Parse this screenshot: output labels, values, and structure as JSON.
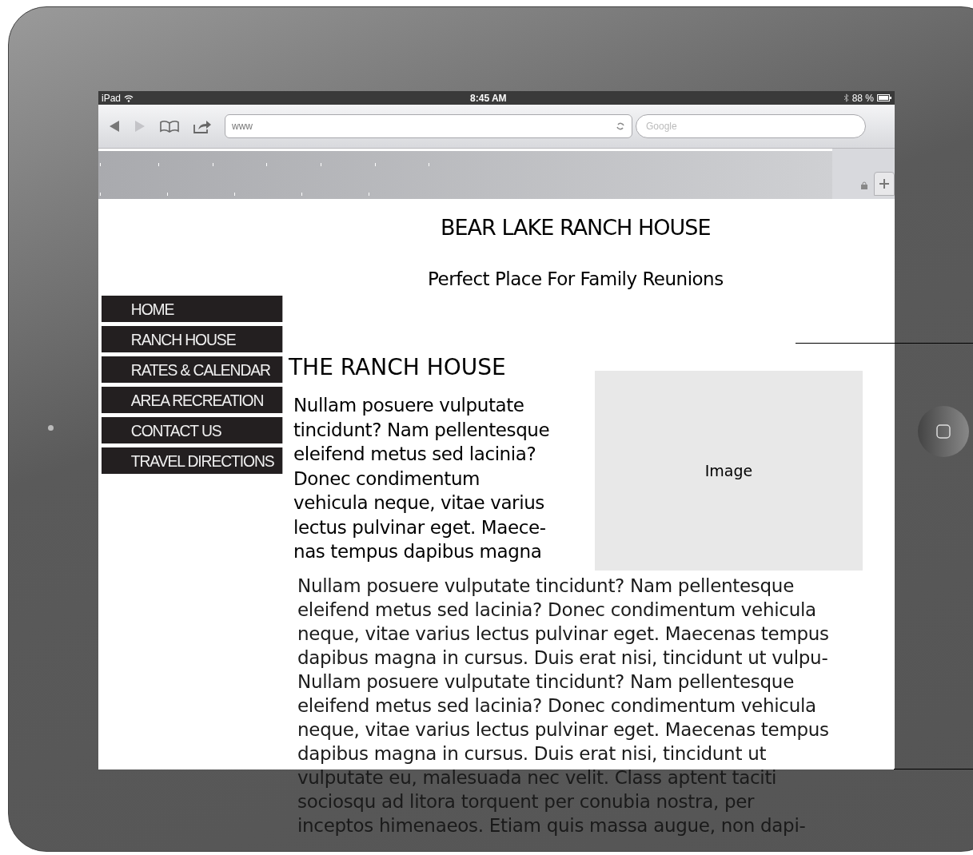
{
  "status_bar": {
    "carrier": "iPad",
    "time": "8:45 AM",
    "battery": "88 %"
  },
  "toolbar": {
    "url": "www",
    "search_placeholder": "Google"
  },
  "page": {
    "title": "BEAR LAKE RANCH HOUSE",
    "tagline": "Perfect Place For Family Reunions",
    "nav": [
      "HOME",
      "RANCH HOUSE",
      "RATES & CALENDAR",
      "AREA RECREATION",
      "CONTACT US",
      "TRAVEL DIRECTIONS"
    ],
    "heading": "THE RANCH HOUSE",
    "intro_lines": [
      "Nullam posuere vulputate",
      "tincidunt? Nam pellentesque",
      "eleifend metus sed lacinia?",
      "Donec condimentum",
      "vehicula neque, vitae varius",
      "lectus pulvinar eget. Maece-",
      "nas tempus dapibus magna"
    ],
    "image_label": "Image",
    "body_lines": [
      "Nullam posuere vulputate tincidunt? Nam pellentesque",
      "eleifend metus sed lacinia? Donec condimentum vehicula",
      "neque, vitae varius lectus pulvinar eget. Maecenas tempus",
      "dapibus magna in cursus. Duis erat nisi, tincidunt ut vulpu-",
      "Nullam posuere vulputate tincidunt? Nam pellentesque",
      "eleifend metus sed lacinia? Donec condimentum vehicula",
      "neque, vitae varius lectus pulvinar eget. Maecenas tempus",
      "dapibus magna in cursus. Duis erat nisi, tincidunt ut",
      "vulputate eu, malesuada nec velit. Class aptent taciti",
      "sociosqu ad litora torquent per conubia nostra, per",
      "inceptos himenaeos. Etiam quis massa augue, non dapi-"
    ]
  }
}
